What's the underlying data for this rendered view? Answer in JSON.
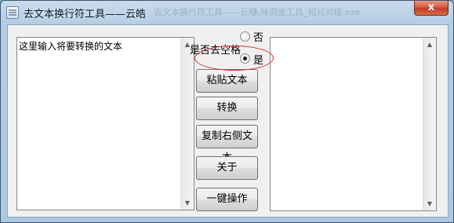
{
  "window": {
    "title": "去文本换行符工具——云皓",
    "ghost_text_1": "去文本换行符工具——云皓",
    "ghost_text_2": "人味调度工具_相对对接.exe",
    "close_label": "x"
  },
  "left_textarea": {
    "value": "这里输入将要转换的文本"
  },
  "controls": {
    "remove_spaces_label": "是否去空格",
    "radio_no_label": "否",
    "radio_yes_label": "是",
    "selected": "是",
    "buttons": {
      "paste": "粘贴文本",
      "convert": "转换",
      "copy_right": "复制右侧文本",
      "about": "关于",
      "one_click": "一键操作"
    }
  },
  "right_textarea": {
    "value": ""
  },
  "icons": {
    "scroll_up": "▲",
    "scroll_down": "▼"
  },
  "colors": {
    "annotation": "#d23030",
    "close_button": "#c33d23"
  }
}
